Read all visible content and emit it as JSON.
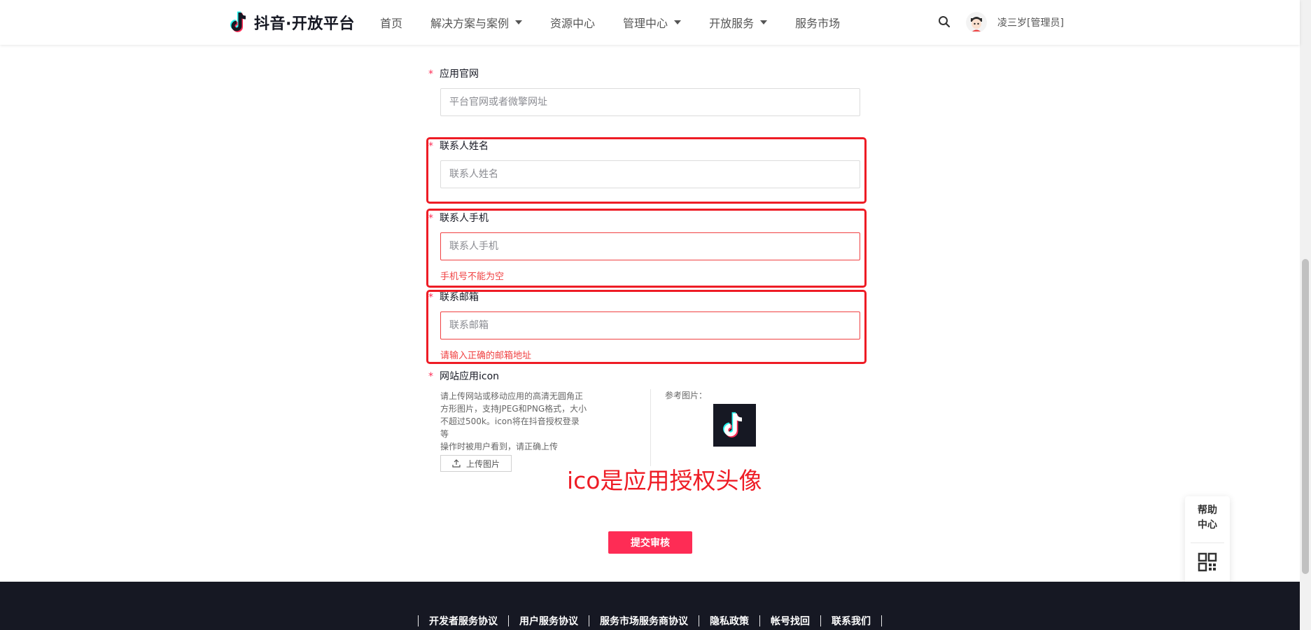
{
  "header": {
    "logo_text": "抖音·开放平台",
    "nav": [
      {
        "label": "首页",
        "dropdown": false
      },
      {
        "label": "解决方案与案例",
        "dropdown": true
      },
      {
        "label": "资源中心",
        "dropdown": false
      },
      {
        "label": "管理中心",
        "dropdown": true
      },
      {
        "label": "开放服务",
        "dropdown": true
      },
      {
        "label": "服务市场",
        "dropdown": false
      }
    ],
    "username": "凌三岁[管理员]"
  },
  "form": {
    "required_mark": "*",
    "website": {
      "label": "应用官网",
      "placeholder": "平台官网或者微擎网址"
    },
    "contact_name": {
      "label": "联系人姓名",
      "placeholder": "联系人姓名"
    },
    "contact_phone": {
      "label": "联系人手机",
      "placeholder": "联系人手机",
      "error": "手机号不能为空"
    },
    "contact_email": {
      "label": "联系邮箱",
      "placeholder": "联系邮箱",
      "error": "请输入正确的邮箱地址"
    },
    "icon": {
      "label": "网站应用icon",
      "description": [
        "请上传网站或移动应用的高清无圆角正",
        "方形图片，支持JPEG和PNG格式，大小",
        "不超过500k。icon将在抖音授权登录等",
        "操作时被用户看到，请正确上传"
      ],
      "reference_label": "参考图片：",
      "upload_label": "上传图片"
    },
    "annotation": "ico是应用授权头像",
    "submit_label": "提交审核"
  },
  "side_panel": {
    "help_line1": "帮助",
    "help_line2": "中心"
  },
  "footer": {
    "links": [
      "开发者服务协议",
      "用户服务协议",
      "服务市场服务商协议",
      "隐私政策",
      "帐号找回",
      "联系我们"
    ]
  },
  "colors": {
    "accent": "#fe2c55",
    "error": "#f04142",
    "annotation": "#ee1c25",
    "footer_bg": "#161823"
  },
  "icons": [
    "tiktok-logo-icon",
    "chevron-down-icon",
    "search-icon",
    "upload-icon",
    "qr-code-icon"
  ]
}
